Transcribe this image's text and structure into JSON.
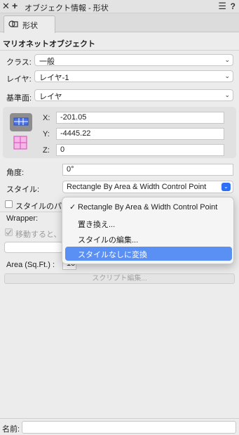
{
  "window": {
    "title": "オブジェクト情報 - 形状",
    "close_glyph": "✕",
    "add_glyph": "+",
    "menu_glyph": "☰",
    "help_glyph": "?"
  },
  "tabs": [
    {
      "label": "形状",
      "icon": "shape-icon"
    }
  ],
  "section": {
    "title": "マリオネットオブジェクト"
  },
  "class": {
    "label": "クラス:",
    "value": "一般"
  },
  "layer": {
    "label": "レイヤ:",
    "value": "レイヤ-1"
  },
  "plane": {
    "label": "基準面:",
    "value": "レイヤ"
  },
  "coords": {
    "x_label": "X:",
    "x_value": "-201.05",
    "y_label": "Y:",
    "y_value": "-4445.22",
    "z_label": "Z:",
    "z_value": "0"
  },
  "angle": {
    "label": "角度:",
    "value": "0°"
  },
  "style": {
    "label": "スタイル:",
    "value": "Rectangle By Area & Width Control Point"
  },
  "style_params": {
    "label": "スタイルのパラ",
    "checked": false
  },
  "wrapper": {
    "label": "Wrapper:",
    "value": ""
  },
  "move_option": {
    "label": "移動すると、コ",
    "checked": true,
    "disabled": true
  },
  "area": {
    "label": "Area (Sq.Ft.) :",
    "value": "100"
  },
  "script_button": {
    "label": "スクリプト編集..."
  },
  "dropdown_menu": {
    "items": [
      {
        "label": "Rectangle By Area & Width Control Point",
        "checked": true
      },
      {
        "label": "置き換え...",
        "checked": false
      },
      {
        "label": "スタイルの編集...",
        "checked": false
      },
      {
        "label": "スタイルなしに変換",
        "checked": false,
        "highlighted": true
      }
    ]
  },
  "name": {
    "label": "名前:",
    "value": ""
  },
  "colors": {
    "accent": "#2d6ff5",
    "highlight": "#5a8ff4"
  }
}
